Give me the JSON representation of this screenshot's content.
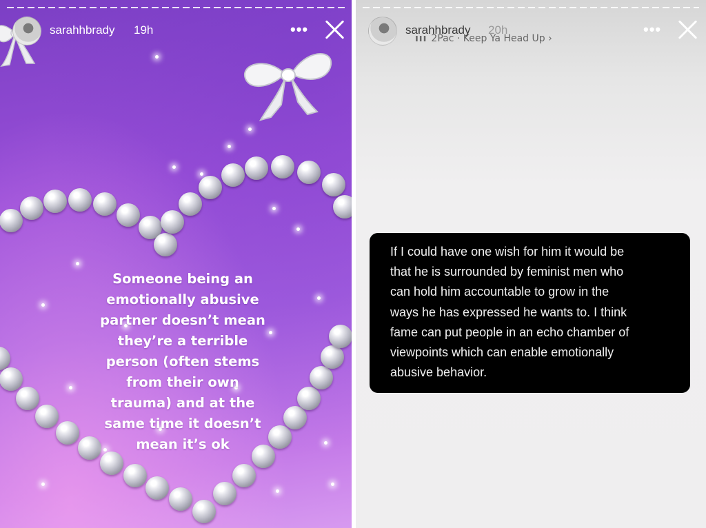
{
  "left_story": {
    "username": "sarahhbrady",
    "time": "19h",
    "more_label": "•••",
    "close_icon": "close-icon",
    "lines": [
      "Someone being an",
      "emotionally abusive",
      "partner doesn’t mean",
      "they’re a terrible",
      "person (often stems",
      "from their own",
      "trauma) and at the",
      "same time it doesn’t",
      "mean it’s ok"
    ]
  },
  "right_story": {
    "username": "sarahhbrady",
    "time": "20h",
    "music_icon": "music-bars-icon",
    "music_label": "2Pac · Keep Ya Head Up ›",
    "more_label": "•••",
    "close_icon": "close-icon",
    "lines": [
      "If I could have one wish for him it would be",
      "that he is surrounded by feminist men who",
      "can hold him accountable to grow in the",
      "ways he has expressed he wants to. I think",
      "fame can put people in an echo chamber of",
      "viewpoints which can enable emotionally",
      "abusive behavior."
    ]
  },
  "colors": {
    "left_background": "#9a4fd9",
    "right_background": "#efeeef",
    "card_background": "#000000",
    "text_white": "#ffffff"
  }
}
